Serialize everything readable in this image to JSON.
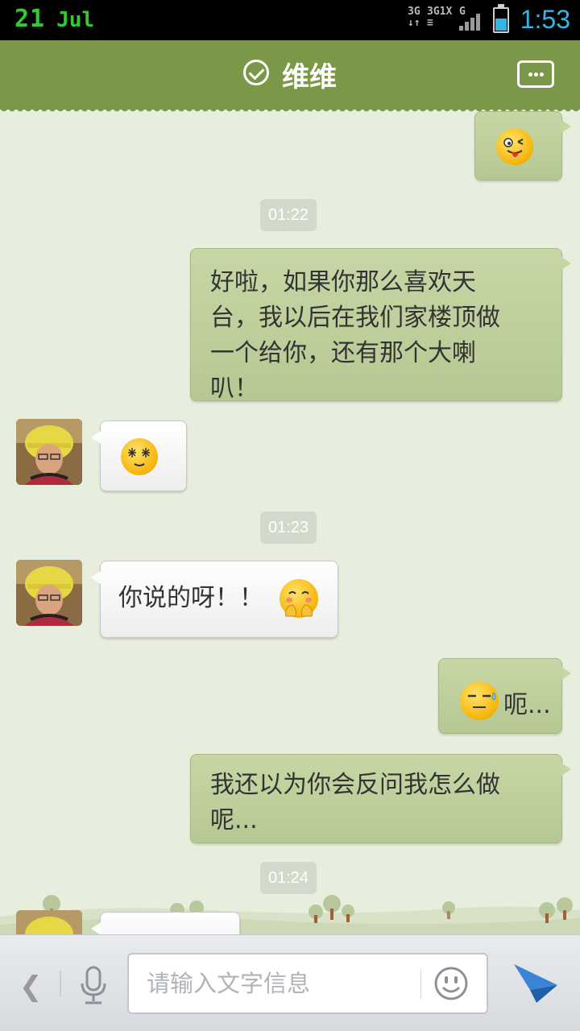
{
  "status_bar": {
    "date_day": "21",
    "date_month": "Jul",
    "network_1": "3G",
    "network_2": "3G",
    "network_3": "1X",
    "network_4": "G",
    "time": "1:53",
    "battery_level": 0.55,
    "time_color": "#33b5e5",
    "date_color": "#2ecc2e"
  },
  "header": {
    "title": "维维",
    "verified_icon": "check-circle-icon",
    "menu_icon": "more-dots-icon",
    "background": "#7b9748"
  },
  "messages": {
    "m1": {
      "direction": "out",
      "emoji": "tongue-wink-emoji"
    },
    "t1": "01:22",
    "m2": {
      "direction": "out",
      "text": "好啦，如果你那么喜欢天台，我以后在我们家楼顶做一个给你，还有那个大喇叭！",
      "line1": "好啦，如果你那么喜欢天",
      "line2": "台，我以后在我们家楼顶做",
      "line3": "一个给你，还有那个大喇",
      "line4": "叭！"
    },
    "m3": {
      "direction": "in",
      "emoji": "dazzled-smile-emoji"
    },
    "t2": "01:23",
    "m4": {
      "direction": "in",
      "text": "你说的呀！！",
      "emoji": "hug-emoji"
    },
    "m5": {
      "direction": "out",
      "text": "呃...",
      "emoji": "sweat-emoji"
    },
    "m6": {
      "direction": "out",
      "text": "我还以为你会反问我怎么做呢...",
      "line1": "我还以为你会反问我怎么做",
      "line2": "呢..."
    },
    "t3": "01:24"
  },
  "input_bar": {
    "back_icon": "chevron-left-icon",
    "mic_icon": "microphone-icon",
    "placeholder": "请输入文字信息",
    "emoji_icon": "smiley-icon",
    "send_icon": "paper-plane-send-icon",
    "send_color": "#3a86d4"
  }
}
